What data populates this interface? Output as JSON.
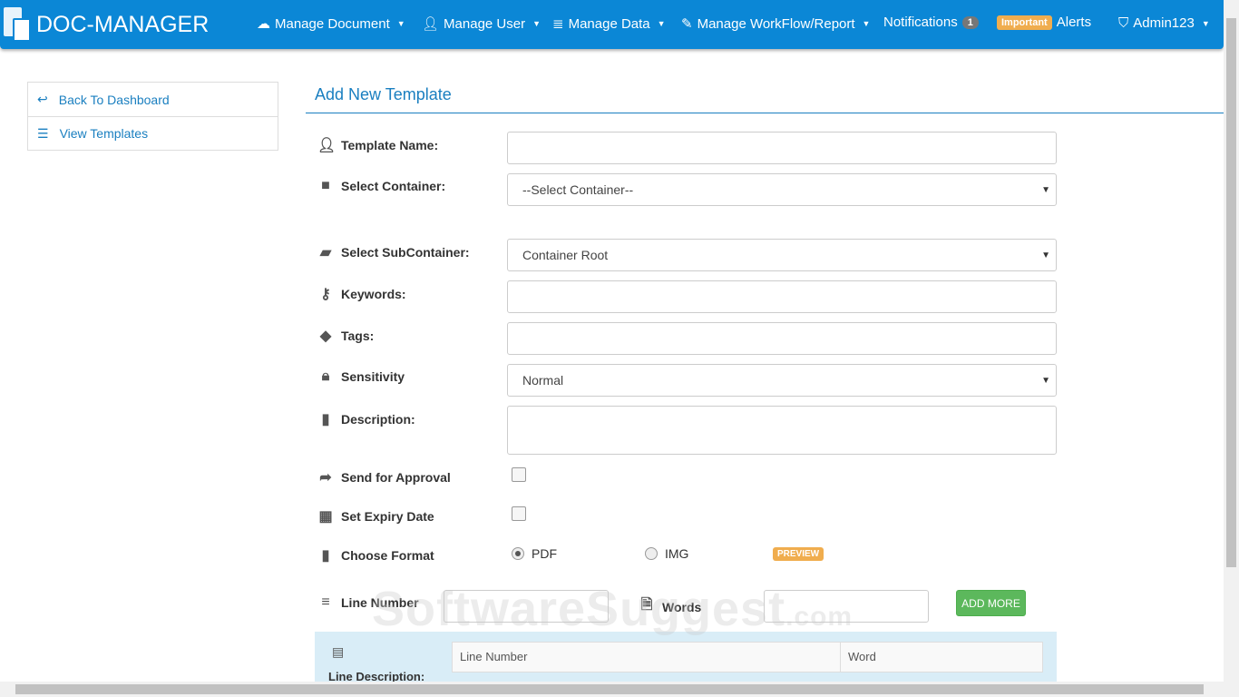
{
  "nav": {
    "brand": "DOC-MANAGER",
    "items": [
      {
        "label": "Manage Document",
        "icon": "cloud-icon"
      },
      {
        "label": "Manage User",
        "icon": "user-icon"
      },
      {
        "label": "Manage Data",
        "icon": "database-icon"
      },
      {
        "label": "Manage WorkFlow/Report",
        "icon": "edit-icon"
      }
    ],
    "notifications": "Notifications",
    "notif_count": "1",
    "important": "Important",
    "alerts": "Alerts",
    "user": "Admin123"
  },
  "sidebar": {
    "items": [
      {
        "label": "Back To Dashboard",
        "icon": "reply-icon"
      },
      {
        "label": "View Templates",
        "icon": "list-icon"
      }
    ]
  },
  "page": {
    "title": "Add New Template"
  },
  "form": {
    "template_name": {
      "label": "Template Name:",
      "value": ""
    },
    "container": {
      "label": "Select Container:",
      "value": "--Select Container--"
    },
    "subcontainer": {
      "label": "Select SubContainer:",
      "value": "Container Root"
    },
    "keywords": {
      "label": "Keywords:",
      "value": ""
    },
    "tags": {
      "label": "Tags:",
      "value": ""
    },
    "sensitivity": {
      "label": "Sensitivity",
      "value": "Normal"
    },
    "description": {
      "label": "Description:",
      "value": ""
    },
    "approval": {
      "label": "Send for Approval",
      "checked": false
    },
    "expiry": {
      "label": "Set Expiry Date",
      "checked": false
    },
    "format": {
      "label": "Choose Format",
      "options": [
        "PDF",
        "IMG"
      ],
      "selected": "PDF",
      "preview": "PREVIEW"
    },
    "line_number": {
      "label": "Line Number",
      "value": ""
    },
    "words": {
      "label": "Words",
      "value": ""
    },
    "add_more": "ADD MORE",
    "line_description": {
      "label": "Line Description:",
      "columns": [
        "Line Number",
        "Word"
      ]
    }
  },
  "watermark": "SoftwareSuggest.com"
}
